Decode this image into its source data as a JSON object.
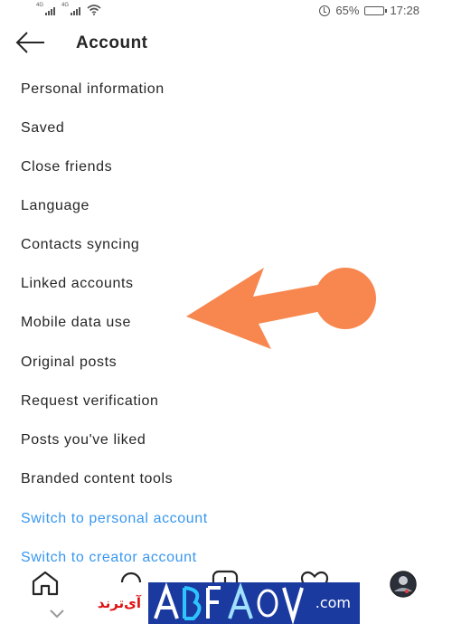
{
  "status_bar": {
    "sim1_tag": "4G",
    "sim2_tag": "4G",
    "battery_percent": "65%",
    "battery_level": 0.65,
    "time": "17:28",
    "icons": [
      "signal-icon",
      "signal-icon",
      "wifi-icon",
      "alarm-icon",
      "battery-icon"
    ]
  },
  "header": {
    "title": "Account"
  },
  "menu": {
    "items": [
      {
        "label": "Personal information"
      },
      {
        "label": "Saved"
      },
      {
        "label": "Close friends"
      },
      {
        "label": "Language"
      },
      {
        "label": "Contacts syncing"
      },
      {
        "label": "Linked accounts"
      },
      {
        "label": "Mobile data use"
      },
      {
        "label": "Original posts"
      },
      {
        "label": "Request verification"
      },
      {
        "label": "Posts you've liked"
      },
      {
        "label": "Branded content tools"
      }
    ],
    "links": [
      {
        "label": "Switch to personal account"
      },
      {
        "label": "Switch to creator account"
      }
    ]
  },
  "annotation": {
    "color": "#f7874f"
  },
  "bottom_nav": {
    "icons": [
      "home-icon",
      "search-icon",
      "add-post-icon",
      "heart-icon",
      "profile-avatar"
    ]
  },
  "watermark": {
    "persian_text": "آی‌ترند",
    "domain_text": ".com",
    "colors": {
      "background": "#1a3aa0",
      "text": "#d11111"
    }
  },
  "colors": {
    "link": "#3897f0",
    "text": "#262626",
    "accent_arrow": "#f7874f"
  }
}
